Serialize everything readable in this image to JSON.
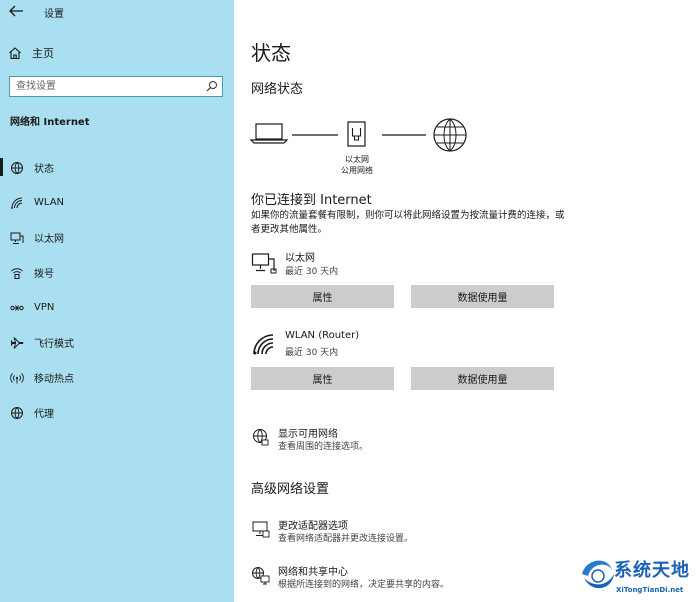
{
  "window": {
    "title": "设置"
  },
  "sidebar": {
    "home_label": "主页",
    "search": {
      "placeholder": "查找设置",
      "value": ""
    },
    "section_label": "网络和 Internet",
    "items": [
      {
        "id": "status",
        "label": "状态",
        "icon": "status-globe-icon",
        "active": true
      },
      {
        "id": "wlan",
        "label": "WLAN",
        "icon": "wifi-icon"
      },
      {
        "id": "ethernet",
        "label": "以太网",
        "icon": "ethernet-icon"
      },
      {
        "id": "dialup",
        "label": "拨号",
        "icon": "dialup-icon"
      },
      {
        "id": "vpn",
        "label": "VPN",
        "icon": "vpn-icon"
      },
      {
        "id": "airplane",
        "label": "飞行模式",
        "icon": "airplane-icon"
      },
      {
        "id": "hotspot",
        "label": "移动热点",
        "icon": "hotspot-icon"
      },
      {
        "id": "proxy",
        "label": "代理",
        "icon": "globe-icon"
      }
    ]
  },
  "main": {
    "title": "状态",
    "network_status_heading": "网络状态",
    "diagram": {
      "middle_label_1": "以太网",
      "middle_label_2": "公用网络"
    },
    "connected_heading": "你已连接到 Internet",
    "connected_desc": "如果你的流量套餐有限制，则你可以将此网络设置为按流量计费的连接，或者更改其他属性。",
    "adapters": [
      {
        "name": "以太网",
        "sub": "最近 30 天内",
        "icon": "ethernet-pc-icon",
        "btn_props": "属性",
        "btn_data": "数据使用量"
      },
      {
        "name": "WLAN (Router)",
        "sub": "最近 30 天内",
        "icon": "wifi-signal-icon",
        "btn_props": "属性",
        "btn_data": "数据使用量"
      }
    ],
    "show_networks": {
      "name": "显示可用网络",
      "sub": "查看周围的连接选项。"
    },
    "advanced_heading": "高级网络设置",
    "adapter_options": {
      "name": "更改适配器选项",
      "sub": "查看网络适配器并更改连接设置。"
    },
    "sharing_center": {
      "name": "网络和共享中心",
      "sub": "根据所连接到的网络，决定要共享的内容。"
    }
  },
  "watermark": {
    "main": "系统天地",
    "sub": "XiTongTianDi.net"
  }
}
